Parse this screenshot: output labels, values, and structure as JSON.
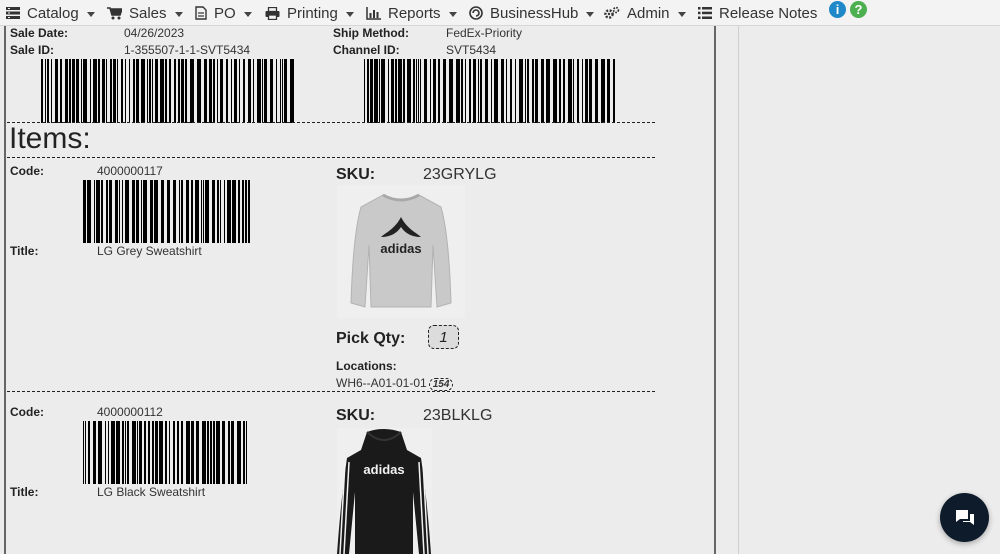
{
  "nav": {
    "catalog": "Catalog",
    "sales": "Sales",
    "po": "PO",
    "printing": "Printing",
    "reports": "Reports",
    "businesshub": "BusinessHub",
    "admin": "Admin",
    "release_notes": "Release Notes",
    "help_glyph": "?",
    "docs_glyph": "i"
  },
  "order": {
    "sale_date_label": "Sale Date:",
    "sale_date": "04/26/2023",
    "sale_id_label": "Sale ID:",
    "sale_id": "1-355507-1-1-SVT5434",
    "ship_method_label": "Ship Method:",
    "ship_method": "FedEx-Priority",
    "channel_id_label": "Channel ID:",
    "channel_id": "SVT5434"
  },
  "items_heading": "Items:",
  "items": [
    {
      "code_label": "Code:",
      "code": "4000000117",
      "title_label": "Title:",
      "title": "LG Grey Sweatshirt",
      "sku_label": "SKU:",
      "sku": "23GRYLG",
      "pick_qty_label": "Pick Qty:",
      "pick_qty": "1",
      "locations_label": "Locations:",
      "location": "WH6--A01-01-01",
      "location_count": "154",
      "image_text": "adidas",
      "image_color": "#c9c9c9"
    },
    {
      "code_label": "Code:",
      "code": "4000000112",
      "title_label": "Title:",
      "title": "LG Black Sweatshirt",
      "sku_label": "SKU:",
      "sku": "23BLKLG",
      "image_text": "adidas",
      "image_color": "#1a1a1a"
    }
  ],
  "colors": {
    "navbar_bg": "#f3f3f3",
    "page_bg": "#ececec",
    "help_green": "#4caf50",
    "docs_blue": "#1e88c8",
    "chat_bg": "#0d1b2a"
  }
}
